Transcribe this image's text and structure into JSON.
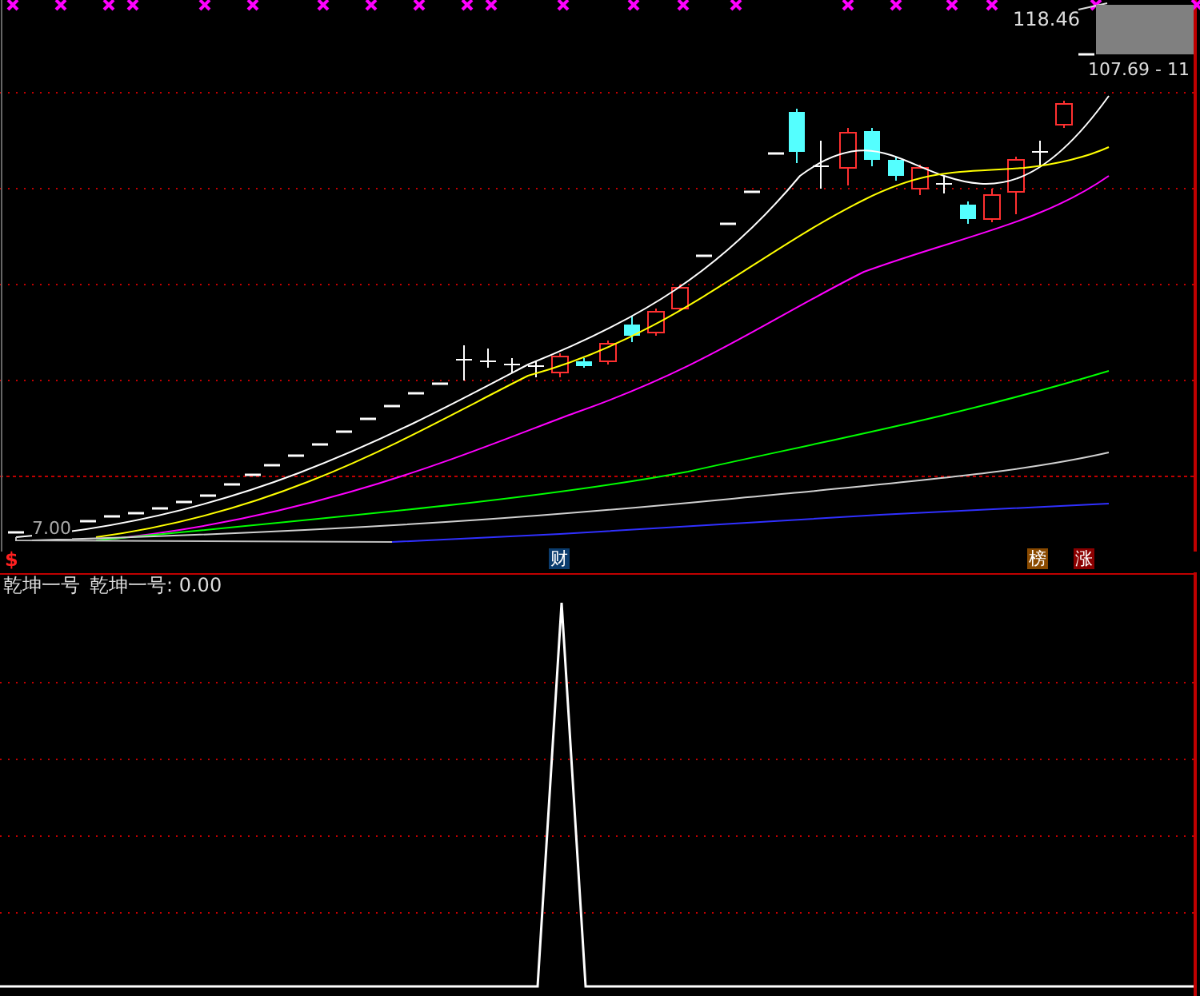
{
  "price_panel": {
    "high_label": "118.46",
    "range_label": "107.69 - 11",
    "low_label": "7.00",
    "signal_mark": "$"
  },
  "event_tags": [
    {
      "text": "财",
      "color": "#0b3c6e"
    },
    {
      "text": "榜",
      "color": "#8a4a00"
    },
    {
      "text": "涨",
      "color": "#8b0000"
    }
  ],
  "indicator_panel": {
    "name": "乾坤一号",
    "value_label": "乾坤一号: 0.00"
  }
}
